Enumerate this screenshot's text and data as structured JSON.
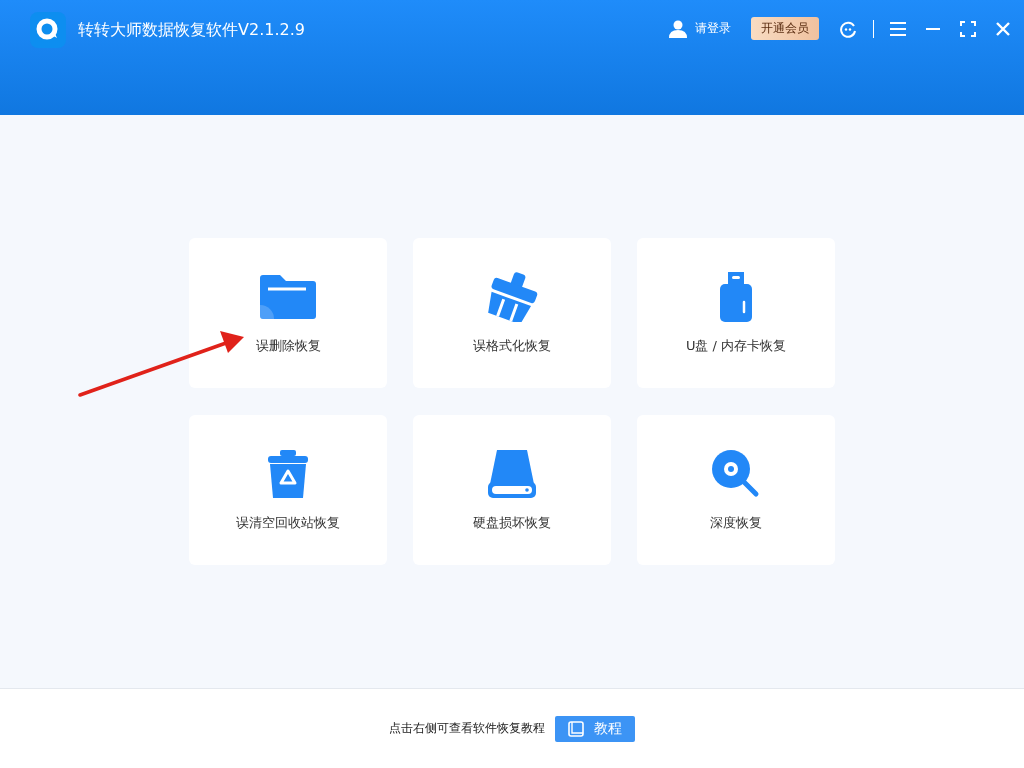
{
  "window": {
    "title": "转转大师数据恢复软件V2.1.2.9"
  },
  "header": {
    "login": "请登录",
    "vip": "开通会员"
  },
  "cards": [
    {
      "kind": "folder",
      "label": "误删除恢复"
    },
    {
      "kind": "broom",
      "label": "误格式化恢复"
    },
    {
      "kind": "usb",
      "label": "U盘 / 内存卡恢复"
    },
    {
      "kind": "recycle",
      "label": "误清空回收站恢复"
    },
    {
      "kind": "disk",
      "label": "硬盘损坏恢复"
    },
    {
      "kind": "deep",
      "label": "深度恢复"
    }
  ],
  "footer": {
    "hint": "点击右侧可查看软件恢复教程",
    "tutorial_button": "教程"
  }
}
